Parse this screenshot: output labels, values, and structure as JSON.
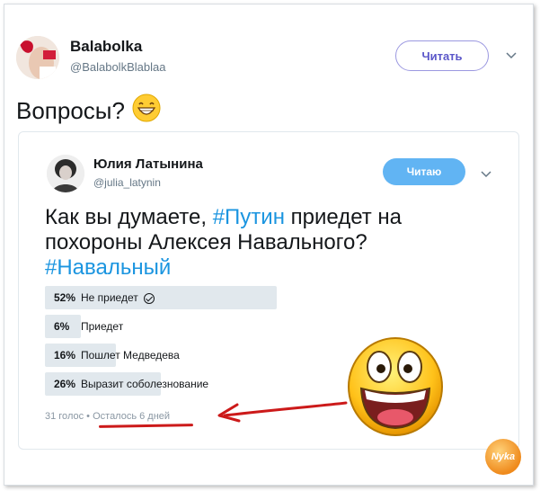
{
  "user": {
    "name": "Balabolka",
    "handle": "@BalabolkBlablaa",
    "follow_label": "Читать"
  },
  "tweet": {
    "text": "Вопросы?"
  },
  "quoted": {
    "name": "Юлия Латынина",
    "handle": "@julia_latynin",
    "follow_label": "Читаю",
    "question_part1": "Как вы думаете, ",
    "hashtag1": "#Путин",
    "question_part2": " приедет на похороны Алексея Навального?",
    "hashtag2": "#Навальный",
    "poll": [
      {
        "pct": "52%",
        "label": "Не приедет",
        "value": 52,
        "selected": true
      },
      {
        "pct": "6%",
        "label": "Приедет",
        "value": 6,
        "selected": false
      },
      {
        "pct": "16%",
        "label": "Пошлет Медведева",
        "value": 16,
        "selected": false
      },
      {
        "pct": "26%",
        "label": "Выразит соболезнование",
        "value": 26,
        "selected": false
      }
    ],
    "votes": "31 голос",
    "separator": "•",
    "time_left": "Осталось 6 дней"
  },
  "watermark": "Nyka",
  "colors": {
    "accent": "#1b95e0",
    "follow_button": "#61b4f3",
    "annotation_red": "#cc1a1a",
    "poll_bar": "#e1e8ed"
  },
  "icons": [
    "chevron-down-icon",
    "grinning-emoji-icon",
    "check-circle-icon",
    "laughing-emoji-icon",
    "red-arrow-icon"
  ]
}
